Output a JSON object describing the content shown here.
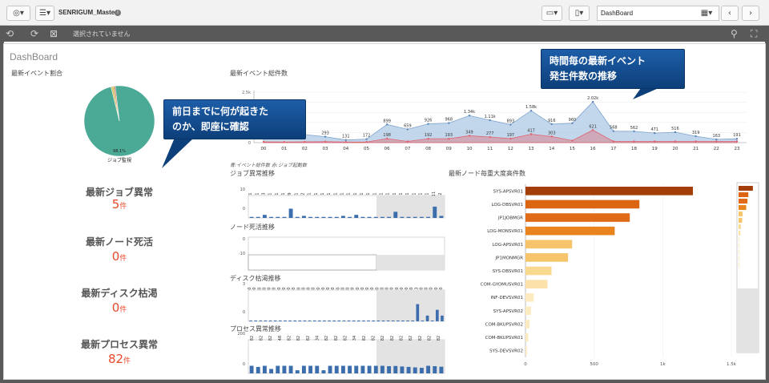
{
  "toolbar": {
    "app_name": "SENRIGUM_Master",
    "info_icon": "i",
    "sheet_name": "DashBoard",
    "prev_icon": "‹",
    "next_icon": "›"
  },
  "selections": {
    "text": "選択されていません"
  },
  "sheet_title": "DashBoard",
  "objects": {
    "pie_title": "最新イベント割合",
    "trend_title": "最新イベント総件数",
    "trend_legend": "青:イベント総件数  赤:ジョブ起動数",
    "job_title": "ジョブ異常推移",
    "node_title": "ノード死活推移",
    "disk_title": "ディスク枯渇推移",
    "proc_title": "プロセス異常推移",
    "node_bar_title": "最新ノード毎重大度高件数"
  },
  "kpis": [
    {
      "label": "最新ジョブ異常",
      "value": "5",
      "unit": "件"
    },
    {
      "label": "最新ノード死活",
      "value": "0",
      "unit": "件"
    },
    {
      "label": "最新ディスク枯渇",
      "value": "0",
      "unit": "件"
    },
    {
      "label": "最新プロセス異常",
      "value": "82",
      "unit": "件"
    }
  ],
  "callouts": {
    "left_line1": "前日までに何が起きた",
    "left_line2": "のか、即座に確認",
    "right_line1": "時間毎の最新イベント",
    "right_line2": "発生件数の推移"
  },
  "colors": {
    "pie": "#4aaa96",
    "trend_blue": "#a9c6e4",
    "trend_red": "#e0646e",
    "bar_blue": "#3c6eae",
    "callout": "#1a5aa3",
    "kpi": "#e8492c"
  },
  "chart_data": [
    {
      "type": "pie",
      "slices": [
        {
          "label": "ジョブ監視",
          "value": 98.1,
          "display": "98.1%"
        },
        {
          "label": "",
          "value": 1.2
        },
        {
          "label": "",
          "value": 0.7
        }
      ],
      "center_label": "98.1%"
    },
    {
      "type": "area",
      "x": [
        "00",
        "01",
        "02",
        "03",
        "04",
        "05",
        "06",
        "07",
        "08",
        "09",
        "10",
        "11",
        "12",
        "13",
        "14",
        "15",
        "16",
        "17",
        "18",
        "19",
        "20",
        "21",
        "22",
        "23"
      ],
      "series": [
        {
          "values": [
            390,
            260,
            400,
            293,
            131,
            172,
            899,
            659,
            926,
            968,
            1340,
            1110,
            893,
            1580,
            916,
            960,
            2020,
            568,
            562,
            471,
            516,
            319,
            163,
            191
          ],
          "labels": [
            "",
            "",
            "",
            "293",
            "131",
            "172",
            "899",
            "659",
            "926",
            "968",
            "1.34k",
            "1.11k",
            "893",
            "1.58k",
            "916",
            "960",
            "2.02k",
            "568",
            "562",
            "471",
            "516",
            "319",
            "163",
            "191"
          ]
        },
        {
          "values": [
            40,
            30,
            40,
            50,
            30,
            30,
            198,
            60,
            192,
            193,
            340,
            277,
            197,
            417,
            303,
            100,
            621,
            60,
            60,
            60,
            60,
            60,
            60,
            60
          ],
          "labels": [
            "",
            "",
            "",
            "",
            "",
            "",
            "198",
            "",
            "192",
            "193",
            "349",
            "277",
            "197",
            "417",
            "303",
            "",
            "621",
            "",
            "",
            "",
            "",
            "",
            "",
            ""
          ]
        }
      ],
      "y_ticks": [
        "2.5k",
        "2k",
        "1.5k",
        "1k",
        "500",
        "0"
      ],
      "ylim": [
        0,
        2500
      ]
    },
    {
      "type": "bar",
      "labels": [
        "1",
        "1",
        "3",
        "1",
        "1",
        "1",
        "9",
        "1",
        "2",
        "1",
        "1",
        "1",
        "1",
        "1",
        "1",
        "1",
        "1",
        "1",
        "1",
        "1",
        "1",
        "1",
        "1",
        "1",
        "1",
        "1",
        "1",
        "1",
        "11",
        "2"
      ],
      "values": [
        1,
        1,
        3,
        1,
        1,
        1,
        9,
        1,
        2,
        1,
        1,
        1,
        1,
        1,
        1,
        1,
        1,
        1,
        1,
        1,
        1,
        1,
        1,
        1,
        1,
        1,
        1,
        1,
        11,
        2
      ],
      "line_values": [
        1,
        1,
        3,
        1,
        1,
        1,
        9,
        1,
        2,
        1,
        1,
        1,
        1,
        1,
        2,
        1,
        3,
        1,
        1,
        1,
        1,
        1,
        6,
        1,
        1,
        1,
        1,
        1,
        11,
        2
      ],
      "y_ticks": [
        "10",
        "0"
      ],
      "ylim": [
        0,
        12
      ]
    },
    {
      "type": "bar",
      "values": [],
      "y_ticks": [
        "0",
        "-10"
      ],
      "ylim": [
        -10,
        10
      ]
    },
    {
      "type": "bar",
      "labels": [
        "0",
        "0",
        "0",
        "0",
        "0",
        "0",
        "0",
        "0",
        "0",
        "0",
        "0",
        "0",
        "0",
        "0",
        "0",
        "0",
        "0",
        "0",
        "0",
        "0",
        "0",
        "0",
        "0",
        "0",
        "0",
        "0",
        "0",
        "0",
        "0",
        "0",
        "0",
        "0",
        "0",
        "0",
        "3",
        "0",
        "0",
        "0",
        "0",
        "0"
      ],
      "values": [
        0,
        0,
        0,
        0,
        0,
        0,
        0,
        0,
        0,
        0,
        0,
        0,
        0,
        0,
        0,
        0,
        0,
        0,
        0,
        0,
        0,
        0,
        0,
        0,
        0,
        0,
        0,
        0,
        0,
        0,
        0,
        0,
        0,
        0,
        3,
        0,
        0,
        0,
        0,
        0
      ],
      "line_values": [
        0,
        0,
        0,
        0,
        0,
        0,
        0,
        0,
        0,
        0,
        0,
        0,
        0,
        0,
        0,
        0,
        0,
        0,
        0,
        0,
        0,
        0,
        0,
        0,
        0,
        0,
        0,
        0,
        0,
        0,
        0,
        0,
        0,
        0,
        3,
        0,
        1,
        0,
        2,
        1
      ],
      "y_ticks": [
        "3",
        "0"
      ],
      "ylim": [
        0,
        3
      ]
    },
    {
      "type": "bar",
      "labels": [
        "82",
        "82",
        "82",
        "48",
        "82",
        "82",
        "82",
        "34",
        "82",
        "82",
        "82",
        "34",
        "82",
        "82",
        "82",
        "82",
        "82",
        "82",
        "82",
        "82",
        "82"
      ],
      "values": [
        82,
        70,
        82,
        48,
        82,
        82,
        82,
        34,
        82,
        82,
        82,
        34,
        82,
        82,
        82,
        82,
        82,
        82,
        82,
        82,
        82
      ],
      "line_values": [
        82,
        70,
        82,
        48,
        82,
        82,
        82,
        34,
        82,
        82,
        82,
        34,
        82,
        82,
        82,
        82,
        82,
        82,
        82,
        82,
        82,
        78,
        80,
        75,
        70,
        65,
        60,
        82,
        78,
        72
      ],
      "y_ticks": [
        "200",
        "0"
      ],
      "ylim": [
        0,
        200
      ]
    },
    {
      "type": "bar",
      "orientation": "horizontal",
      "categories": [
        "SYS-APSVR01",
        "LOG-DBSVR01",
        "JP1JOBMGR",
        "LOG-MONSVR01",
        "LOG-APSVR01",
        "JP1MONMGR",
        "SYS-DBSVR01",
        "COM-GYOMUSVR01",
        "INF-DEVSVR01",
        "SYS-APSVR02",
        "COM-BKUPSVR02",
        "COM-BKUPSVR01",
        "SYS-DEVSVR02"
      ],
      "values": [
        1220,
        830,
        760,
        650,
        340,
        310,
        190,
        160,
        60,
        40,
        30,
        20,
        10
      ],
      "colors": [
        "#a33e08",
        "#dc6512",
        "#e06a18",
        "#e8831e",
        "#f6c56b",
        "#f6c56b",
        "#f9d88f",
        "#fbe2a8",
        "#fcebc0",
        "#fcebc0",
        "#fcebc0",
        "#fcebc0",
        "#fcebc0"
      ],
      "x_ticks": [
        "0",
        "500",
        "1k",
        "1.5k"
      ],
      "xlim": [
        0,
        1500
      ]
    }
  ]
}
